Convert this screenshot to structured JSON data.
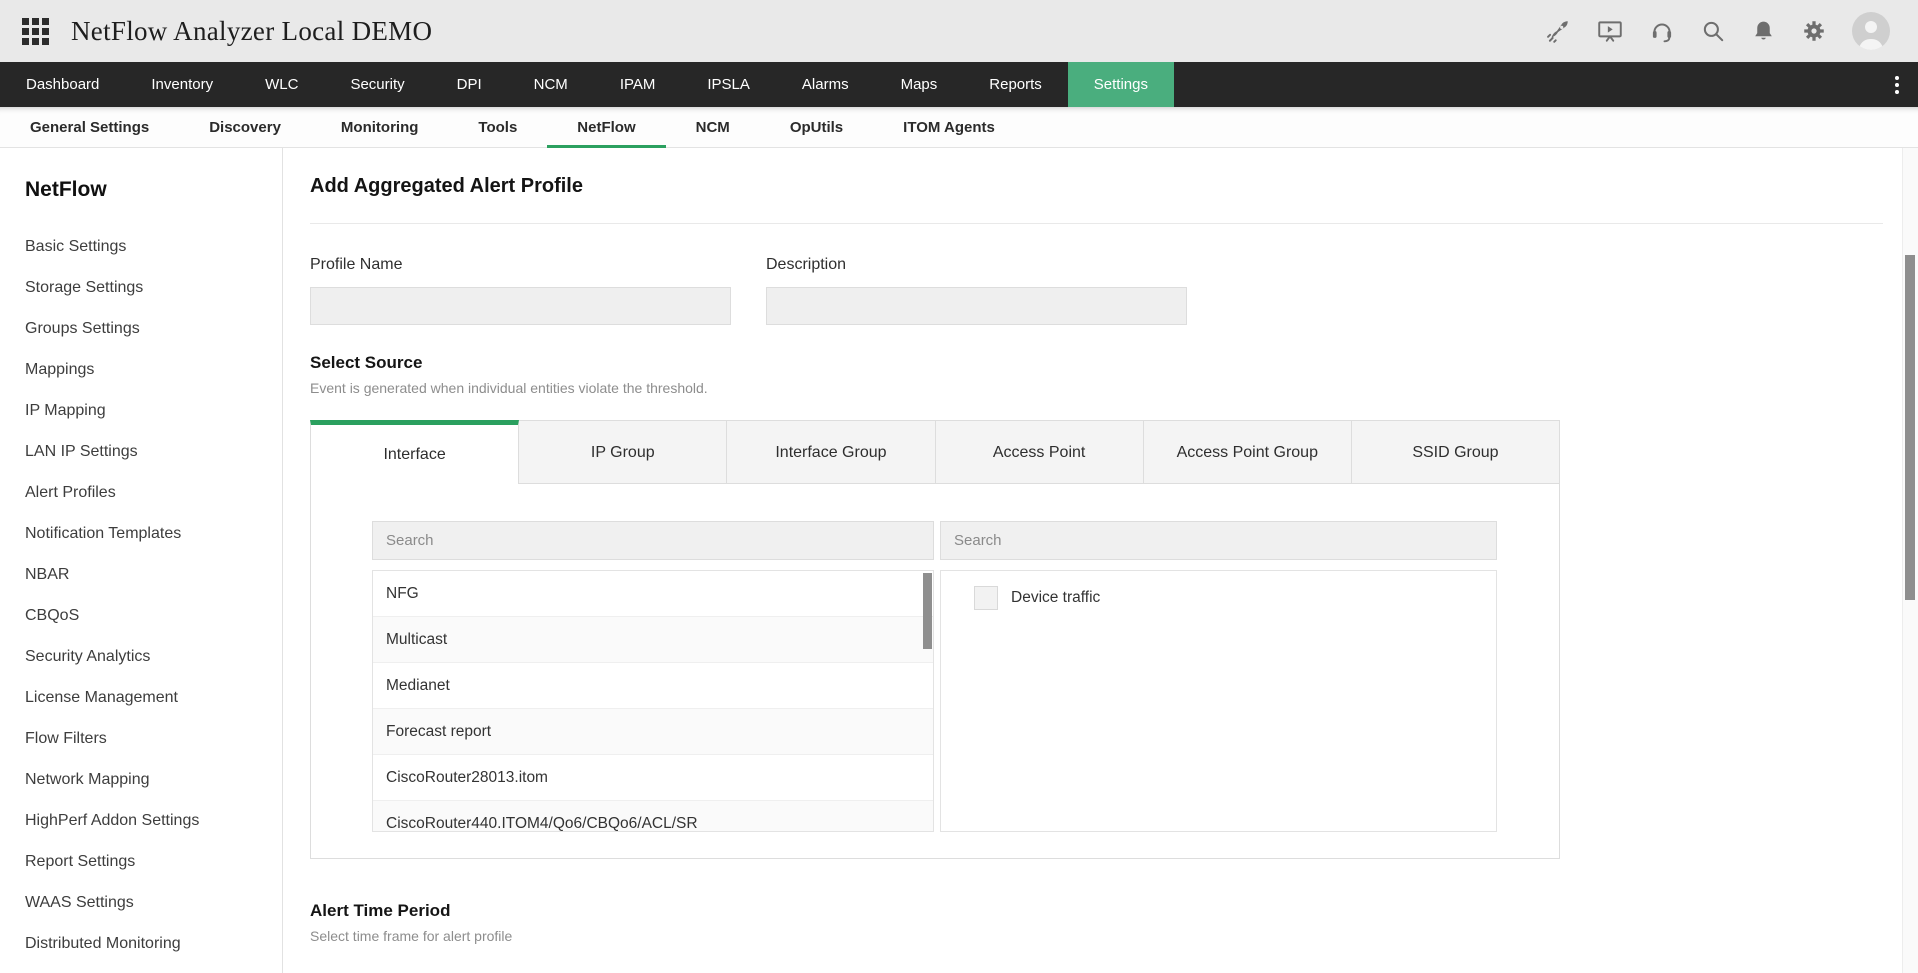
{
  "topbar": {
    "title": "NetFlow Analyzer Local DEMO",
    "icons": [
      "apps-grid",
      "rocket",
      "demo-player",
      "support-headset",
      "search",
      "notifications-bell",
      "settings-gear",
      "user-avatar"
    ]
  },
  "mainnav": {
    "items": [
      {
        "label": "Dashboard"
      },
      {
        "label": "Inventory"
      },
      {
        "label": "WLC"
      },
      {
        "label": "Security"
      },
      {
        "label": "DPI"
      },
      {
        "label": "NCM"
      },
      {
        "label": "IPAM"
      },
      {
        "label": "IPSLA"
      },
      {
        "label": "Alarms"
      },
      {
        "label": "Maps"
      },
      {
        "label": "Reports"
      },
      {
        "label": "Settings",
        "active": true
      }
    ]
  },
  "subnav": {
    "items": [
      {
        "label": "General Settings"
      },
      {
        "label": "Discovery"
      },
      {
        "label": "Monitoring"
      },
      {
        "label": "Tools"
      },
      {
        "label": "NetFlow",
        "active": true
      },
      {
        "label": "NCM"
      },
      {
        "label": "OpUtils"
      },
      {
        "label": "ITOM Agents"
      }
    ]
  },
  "sidebar": {
    "title": "NetFlow",
    "items": [
      "Basic Settings",
      "Storage Settings",
      "Groups Settings",
      "Mappings",
      "IP Mapping",
      "LAN IP Settings",
      "Alert Profiles",
      "Notification Templates",
      "NBAR",
      "CBQoS",
      "Security Analytics",
      "License Management",
      "Flow Filters",
      "Network Mapping",
      "HighPerf Addon Settings",
      "Report Settings",
      "WAAS Settings",
      "Distributed Monitoring"
    ]
  },
  "content": {
    "page_title": "Add Aggregated Alert Profile",
    "profile_name": {
      "label": "Profile Name",
      "value": ""
    },
    "description": {
      "label": "Description",
      "value": ""
    },
    "select_source": {
      "heading": "Select Source",
      "subtitle": "Event is generated when individual entities violate the threshold."
    },
    "source_tabs": [
      {
        "label": "Interface",
        "active": true
      },
      {
        "label": "IP Group"
      },
      {
        "label": "Interface Group"
      },
      {
        "label": "Access Point"
      },
      {
        "label": "Access Point Group"
      },
      {
        "label": "SSID Group"
      }
    ],
    "interface_list": {
      "search_placeholder": "Search",
      "items": [
        "NFG",
        "Multicast",
        "Medianet",
        "Forecast report",
        "CiscoRouter28013.itom",
        "CiscoRouter440.ITOM4/Qo6/CBQo6/ACL/SR"
      ]
    },
    "selected_panel": {
      "search_placeholder": "Search",
      "checkbox": {
        "label": "Device traffic",
        "checked": false
      }
    },
    "alert_time_period": {
      "heading": "Alert Time Period",
      "subtitle": "Select time frame for alert profile"
    }
  },
  "colors": {
    "accent_green": "#2ba05f",
    "active_nav_green": "#4aae7e",
    "nav_dark": "#272727",
    "topbar_gray": "#e9e9e9"
  }
}
